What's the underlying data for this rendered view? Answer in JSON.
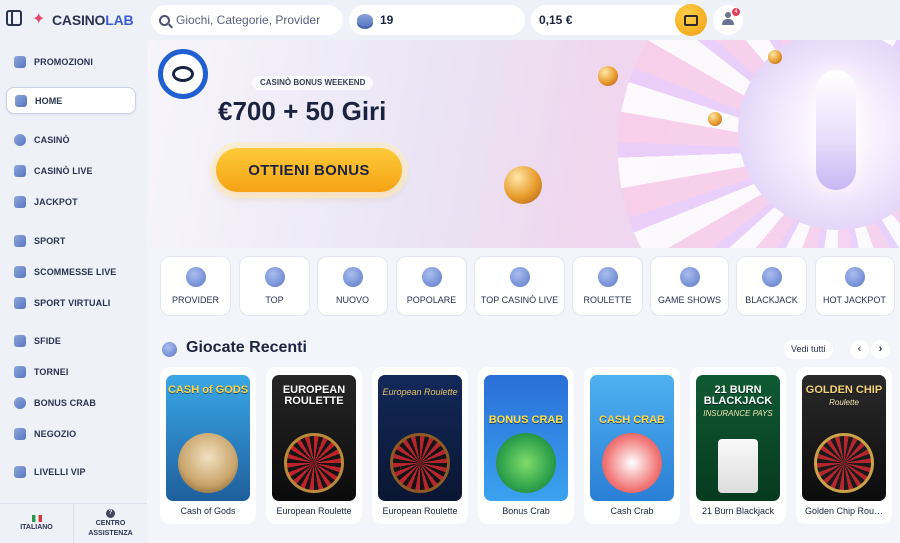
{
  "brand": {
    "name_a": "CASINO",
    "name_b": "LAB"
  },
  "header": {
    "search_placeholder": "Giochi, Categorie, Provider",
    "coins": "19",
    "balance": "0,15 €",
    "notifications_count": "4"
  },
  "sidebar": {
    "items": [
      {
        "label": "PROMOZIONI",
        "icon": "promo-icon"
      },
      {
        "label": "HOME",
        "icon": "home-icon",
        "active": true
      },
      {
        "label": "CASINÒ",
        "icon": "casino-chip-icon"
      },
      {
        "label": "CASINÒ LIVE",
        "icon": "live-casino-icon"
      },
      {
        "label": "JACKPOT",
        "icon": "jackpot-icon"
      },
      {
        "label": "SPORT",
        "icon": "sport-icon"
      },
      {
        "label": "SCOMMESSE LIVE",
        "icon": "live-bets-icon"
      },
      {
        "label": "SPORT VIRTUALI",
        "icon": "virtual-sport-icon"
      },
      {
        "label": "SFIDE",
        "icon": "challenges-icon"
      },
      {
        "label": "TORNEI",
        "icon": "trophy-icon"
      },
      {
        "label": "BONUS CRAB",
        "icon": "bonus-crab-icon"
      },
      {
        "label": "NEGOZIO",
        "icon": "shop-icon"
      },
      {
        "label": "LIVELLI VIP",
        "icon": "vip-icon"
      }
    ],
    "language": "ITALIANO",
    "support_line1": "CENTRO",
    "support_line2": "ASSISTENZA"
  },
  "hero": {
    "kicker": "CASINÒ BONUS WEEKEND",
    "title": "€700 + 50 Giri",
    "cta": "OTTIENI BONUS"
  },
  "categories": [
    {
      "label": "PROVIDER",
      "icon": "funnel-icon"
    },
    {
      "label": "TOP",
      "icon": "top-star-icon"
    },
    {
      "label": "NUOVO",
      "icon": "new-badge-icon"
    },
    {
      "label": "POPOLARE",
      "icon": "star-icon"
    },
    {
      "label": "TOP CASINÒ LIVE",
      "icon": "live-star-icon"
    },
    {
      "label": "ROULETTE",
      "icon": "roulette-icon"
    },
    {
      "label": "GAME SHOWS",
      "icon": "game-show-icon"
    },
    {
      "label": "BLACKJACK",
      "icon": "cards-icon"
    },
    {
      "label": "HOT JACKPOT",
      "icon": "hot-jackpot-icon"
    }
  ],
  "recent": {
    "title": "Giocate Recenti",
    "see_all": "Vedi tutti",
    "prev": "‹",
    "next": "›",
    "games": [
      {
        "name": "Cash of Gods",
        "thumb_title": "CASH of GODS",
        "thumb_sub": "",
        "bg": "#2f8fcf"
      },
      {
        "name": "European Roulette",
        "thumb_title": "EUROPEAN ROULETTE",
        "thumb_sub": "",
        "bg": "#141414"
      },
      {
        "name": "European Roulette",
        "thumb_title": "",
        "thumb_sub": "European Roulette",
        "bg": "#0f1d3f"
      },
      {
        "name": "Bonus Crab",
        "thumb_title": "BONUS CRAB",
        "thumb_sub": "",
        "bg": "#2a74d8"
      },
      {
        "name": "Cash Crab",
        "thumb_title": "CASH CRAB",
        "thumb_sub": "",
        "bg": "#3aa0e8"
      },
      {
        "name": "21 Burn Blackjack",
        "thumb_title": "21 BURN BLACKJACK",
        "thumb_sub": "INSURANCE PAYS",
        "bg": "#0d4a2b"
      },
      {
        "name": "Golden Chip Rou…",
        "thumb_title": "GOLDEN CHIP",
        "thumb_sub": "Roulette",
        "bg": "#1a1a1a"
      }
    ]
  },
  "colors": {
    "accent": "#f5a214",
    "brand_blue": "#1f5fd1",
    "text": "#1b2340"
  }
}
